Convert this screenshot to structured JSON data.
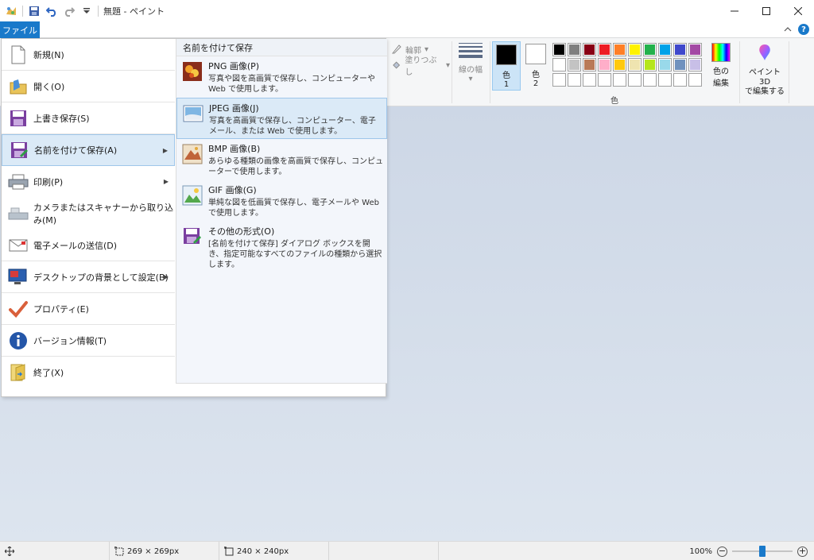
{
  "window": {
    "title": "無題 - ペイント"
  },
  "tabs": {
    "file": "ファイル"
  },
  "ribbon": {
    "outline": "輪郭",
    "fill": "塗りつぶし",
    "line_width": "線の幅",
    "color1_label": "色",
    "color1_num": "1",
    "color2_label": "色",
    "color2_num": "2",
    "edit_colors_line1": "色の",
    "edit_colors_line2": "編集",
    "paint3d_line1": "ペイント 3D",
    "paint3d_line2": "で編集する",
    "colors_group": "色",
    "palette": [
      "#000000",
      "#7f7f7f",
      "#880015",
      "#ed1c24",
      "#ff7f27",
      "#fff200",
      "#22b14c",
      "#00a2e8",
      "#3f48cc",
      "#a349a4",
      "#ffffff",
      "#c3c3c3",
      "#b97a57",
      "#ffaec9",
      "#ffc90e",
      "#efe4b0",
      "#b5e61d",
      "#99d9ea",
      "#7092be",
      "#c8bfe7",
      "#ffffff",
      "#ffffff",
      "#ffffff",
      "#ffffff",
      "#ffffff",
      "#ffffff",
      "#ffffff",
      "#ffffff",
      "#ffffff",
      "#ffffff"
    ],
    "primary_color": "#000000",
    "secondary_color": "#ffffff"
  },
  "file_menu": {
    "items": [
      {
        "label": "新規(N)",
        "icon": "new-file-icon"
      },
      {
        "label": "開く(O)",
        "icon": "open-folder-icon"
      },
      {
        "label": "上書き保存(S)",
        "icon": "save-icon"
      },
      {
        "label": "名前を付けて保存(A)",
        "icon": "save-as-icon"
      },
      {
        "label": "印刷(P)",
        "icon": "printer-icon"
      },
      {
        "label": "カメラまたはスキャナーから取り込み(M)",
        "icon": "scanner-icon"
      },
      {
        "label": "電子メールの送信(D)",
        "icon": "email-icon"
      },
      {
        "label": "デスクトップの背景として設定(B)",
        "icon": "desktop-icon"
      },
      {
        "label": "プロパティ(E)",
        "icon": "checkmark-icon"
      },
      {
        "label": "バージョン情報(T)",
        "icon": "info-icon"
      },
      {
        "label": "終了(X)",
        "icon": "exit-icon"
      }
    ],
    "submenu": {
      "header": "名前を付けて保存",
      "items": [
        {
          "title": "PNG 画像(P)",
          "desc": "写真や図を高画質で保存し、コンピューターや Web で使用します。"
        },
        {
          "title": "JPEG 画像(J)",
          "desc": "写真を高画質で保存し、コンピューター、電子メール、または Web で使用します。"
        },
        {
          "title": "BMP 画像(B)",
          "desc": "あらゆる種類の画像を高画質で保存し、コンピューターで使用します。"
        },
        {
          "title": "GIF 画像(G)",
          "desc": "単純な図を低画質で保存し、電子メールや Web で使用します。"
        },
        {
          "title": "その他の形式(O)",
          "desc": "[名前を付けて保存] ダイアログ ボックスを開き、指定可能なすべてのファイルの種類から選択します。"
        }
      ]
    }
  },
  "status": {
    "selection_size": "269 × 269px",
    "image_size": "240 × 240px",
    "zoom": "100%",
    "zoom_fraction": 0.5
  }
}
